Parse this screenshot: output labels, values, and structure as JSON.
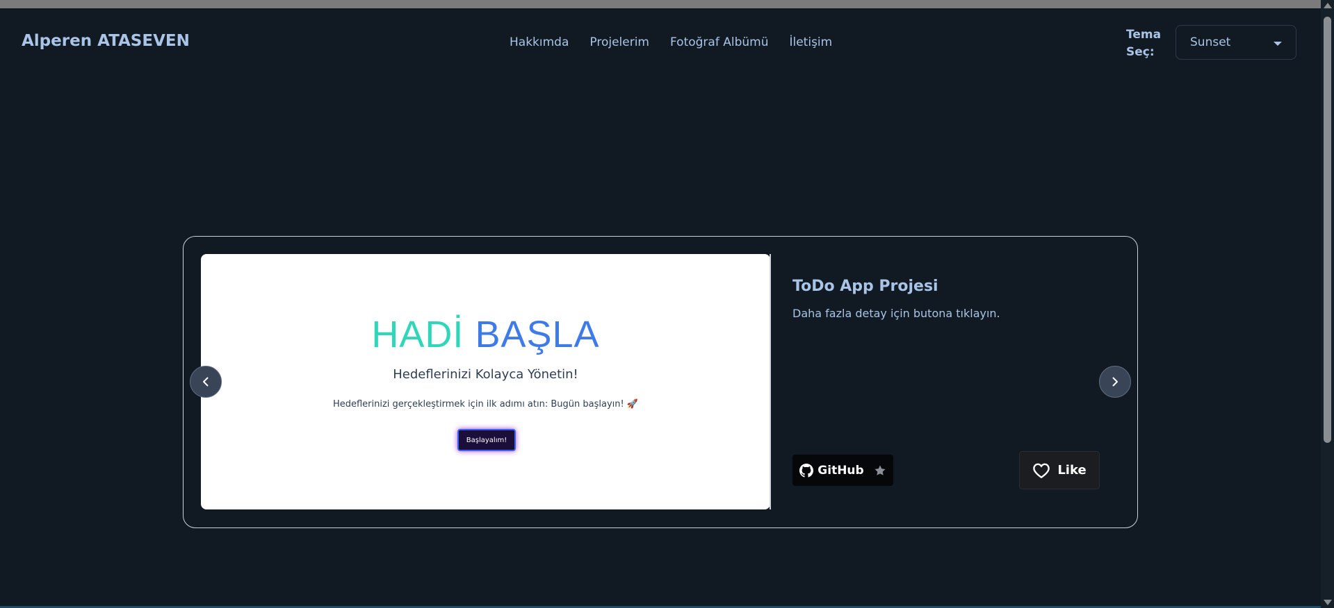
{
  "header": {
    "brand": "Alperen ATASEVEN",
    "nav": [
      "Hakkımda",
      "Projelerim",
      "Fotoğraf Albümü",
      "İletişim"
    ],
    "theme_label": "Tema Seç:",
    "theme_value": "Sunset"
  },
  "slide": {
    "screenshot": {
      "title_part1": "HADİ",
      "title_part2": "BAŞLA",
      "subtitle": "Hedeflerinizi Kolayca Yönetin!",
      "description": "Hedeflerinizi gerçekleştirmek için ilk adımı atın: Bugün başlayın! 🚀",
      "button": "Başlayalım!"
    },
    "project_title": "ToDo App Projesi",
    "project_description": "Daha fazla detay için butona tıklayın.",
    "github_label": "GitHub",
    "like_label": "Like"
  },
  "icons": {
    "prev": "chevron-left-icon",
    "next": "chevron-right-icon",
    "github": "github-icon",
    "star": "star-icon",
    "like": "heart-icon",
    "dropdown": "caret-down-icon"
  }
}
